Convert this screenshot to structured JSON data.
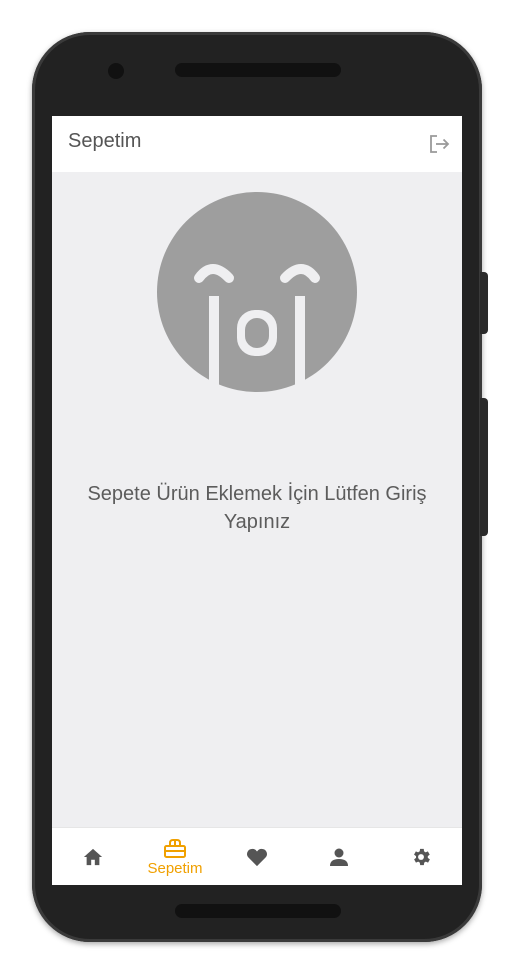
{
  "header": {
    "title": "Sepetim",
    "logout_icon": "logout-icon"
  },
  "empty_state": {
    "icon": "crying-face-icon",
    "message": "Sepete Ürün Eklemek İçin Lütfen Giriş Yapınız"
  },
  "bottom_nav": {
    "items": [
      {
        "icon": "home-icon",
        "label": ""
      },
      {
        "icon": "basket-icon",
        "label": "Sepetim",
        "active": true
      },
      {
        "icon": "heart-icon",
        "label": ""
      },
      {
        "icon": "user-icon",
        "label": ""
      },
      {
        "icon": "gear-icon",
        "label": ""
      }
    ]
  },
  "colors": {
    "accent": "#f0a000",
    "icon_gray": "#555555",
    "emoji_gray": "#9e9e9e",
    "screen_bg": "#efeff1"
  }
}
